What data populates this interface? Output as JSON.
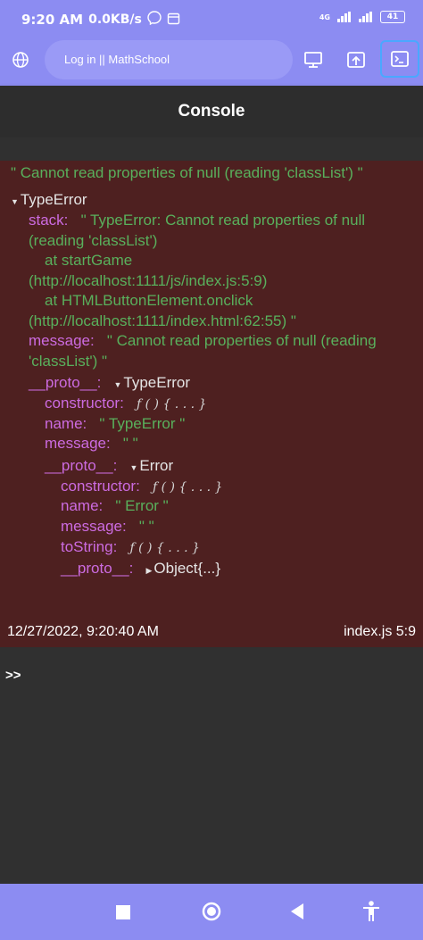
{
  "status": {
    "time": "9:20 AM",
    "speed": "0.0KB/s",
    "network": "4G",
    "battery": "41"
  },
  "toolbar": {
    "url_text": "Log in || MathSchool"
  },
  "header": {
    "title": "Console"
  },
  "console": {
    "error_message": "\" Cannot read properties of null (reading 'classList') \"",
    "type_error": "TypeError",
    "stack_key": "stack:",
    "stack_lines": [
      "\" TypeError: Cannot read properties of null",
      "(reading 'classList')",
      "at startGame",
      "(http://localhost:1111/js/index.js:5:9)",
      "at HTMLButtonElement.onclick",
      "(http://localhost:1111/index.html:62:55) \""
    ],
    "message_key": "message:",
    "message_lines": [
      "\" Cannot read properties of null (reading",
      "'classList') \""
    ],
    "proto_key": "__proto__:",
    "proto_value": "TypeError",
    "constructor_key": "constructor:",
    "fn_value": "ƒ ( ) { . . . }",
    "name_key": "name:",
    "name_value": "\" TypeError \"",
    "message2_key": "message:",
    "message2_value": "\" \"",
    "proto2_key": "__proto__:",
    "proto2_value": "Error",
    "constructor2_key": "constructor:",
    "fn_value2": "ƒ ( ) { . . . }",
    "name2_key": "name:",
    "name2_value": "\" Error \"",
    "message3_key": "message:",
    "message3_value": "\" \"",
    "tostring_key": "toString:",
    "fn_value3": "ƒ ( ) { . . . }",
    "proto3_key": "__proto__:",
    "proto3_value": "Object{...}",
    "timestamp": "12/27/2022, 9:20:40 AM",
    "source": "index.js 5:9"
  },
  "input": {
    "prompt": ">>"
  }
}
